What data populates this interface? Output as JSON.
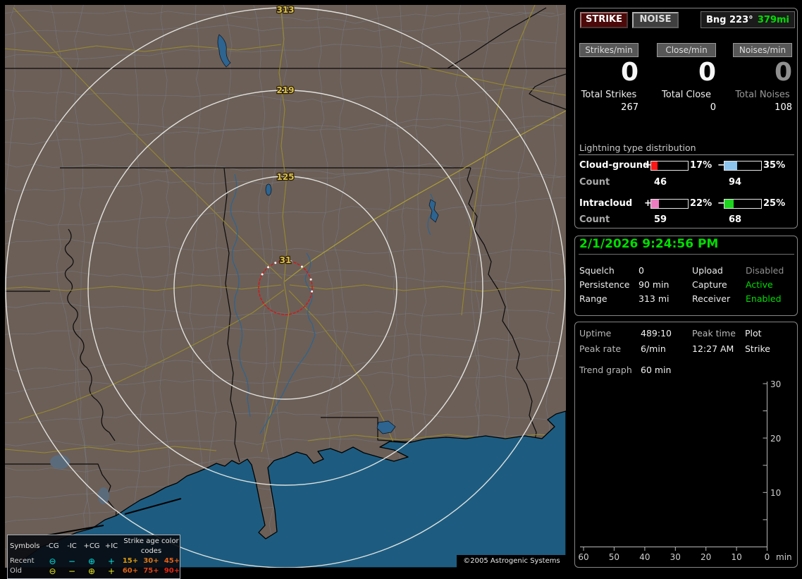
{
  "map": {
    "rings": [
      "313",
      "219",
      "125",
      "31"
    ],
    "colors": {
      "land": "#6c5f57",
      "water": "#1d5c80",
      "range_ring": "#e8e8e4",
      "alarm_ring": "#d81414",
      "ring_label": "#d8c24a"
    },
    "copyright": "©2005 Astrogenic Systems",
    "legend": {
      "headers": [
        "Symbols",
        "-CG",
        "-IC",
        "+CG",
        "+IC"
      ],
      "age_header": "Strike age color codes",
      "rows": [
        {
          "label": "Recent",
          "symbol_color": "#00e2e2",
          "neg_cg": "⊖",
          "neg_ic": "−",
          "pos_cg": "⊕",
          "pos_ic": "+",
          "ages": [
            {
              "text": "15+",
              "color": "#dc9a10"
            },
            {
              "text": "30+",
              "color": "#e07818"
            },
            {
              "text": "45+",
              "color": "#e66018"
            }
          ]
        },
        {
          "label": "Old",
          "symbol_color": "#e8e818",
          "neg_cg": "⊖",
          "neg_ic": "−",
          "pos_cg": "⊕",
          "pos_ic": "+",
          "ages": [
            {
              "text": "60+",
              "color": "#e06414"
            },
            {
              "text": "75+",
              "color": "#e04214"
            },
            {
              "text": "90+",
              "color": "#ea2410"
            }
          ]
        }
      ]
    }
  },
  "panel_top": {
    "strike_button": "STRIKE",
    "noise_button": "NOISE",
    "bearing": {
      "label": "Bng 223°",
      "distance": "379mi",
      "distance_color": "#00dd00"
    },
    "counters": [
      {
        "label": "Strikes/min",
        "rate": "0",
        "total_label": "Total Strikes",
        "total": "267"
      },
      {
        "label": "Close/min",
        "rate": "0",
        "total_label": "Total Close",
        "total": "0"
      },
      {
        "label": "Noises/min",
        "rate": "0",
        "total_label": "Total Noises",
        "total": "108"
      }
    ],
    "distribution": {
      "title": "Lightning type distribution",
      "rows": [
        {
          "label": "Cloud-ground",
          "plus_sign": "+",
          "plus_pct": "17%",
          "plus_color": "#ff1616",
          "minus_sign": "−",
          "minus_pct": "35%",
          "minus_color": "#8cc4ee",
          "count_label": "Count",
          "plus_count": "46",
          "minus_count": "94"
        },
        {
          "label": "Intracloud",
          "plus_sign": "+",
          "plus_pct": "22%",
          "plus_color": "#ec7cc0",
          "minus_sign": "−",
          "minus_pct": "25%",
          "minus_color": "#1ed41e",
          "count_label": "Count",
          "plus_count": "59",
          "minus_count": "68"
        }
      ]
    }
  },
  "panel_status": {
    "datetime": "2/1/2026 9:24:56 PM",
    "datetime_color": "#00dd00",
    "rows": [
      {
        "l1": "Squelch",
        "v1": "0",
        "v1_color": "#f2f2f2",
        "l2": "Upload",
        "v2": "Disabled",
        "v2_color": "#8f8f8f"
      },
      {
        "l1": "Persistence",
        "v1": "90 min",
        "v1_color": "#f2f2f2",
        "l2": "Capture",
        "v2": "Active",
        "v2_color": "#00dd00"
      },
      {
        "l1": "Range",
        "v1": "313 mi",
        "v1_color": "#f2f2f2",
        "l2": "Receiver",
        "v2": "Enabled",
        "v2_color": "#00dd00"
      }
    ]
  },
  "panel_trend": {
    "rows": [
      {
        "l1": "Uptime",
        "v1": "489:10",
        "c3": "Peak time",
        "c4": "Plot"
      },
      {
        "l1": "Peak rate",
        "v1": "6/min",
        "c3": "12:27 AM",
        "c4": "Strike"
      },
      {
        "l1": "Trend graph",
        "v1": "60 min",
        "c3": "",
        "c4": ""
      }
    ],
    "graph": {
      "y_ticks": [
        "30",
        "20",
        "10"
      ],
      "x_ticks": [
        "60",
        "50",
        "40",
        "30",
        "20",
        "10",
        "0"
      ],
      "x_unit": "min"
    }
  },
  "chart_data": {
    "type": "line",
    "title": "Trend graph 60 min",
    "xlabel": "min",
    "x_ticks": [
      60,
      50,
      40,
      30,
      20,
      10,
      0
    ],
    "y_ticks": [
      10,
      20,
      30
    ],
    "ylim": [
      0,
      30
    ],
    "series": [],
    "note": "empty trend plot - no strikes in window"
  }
}
